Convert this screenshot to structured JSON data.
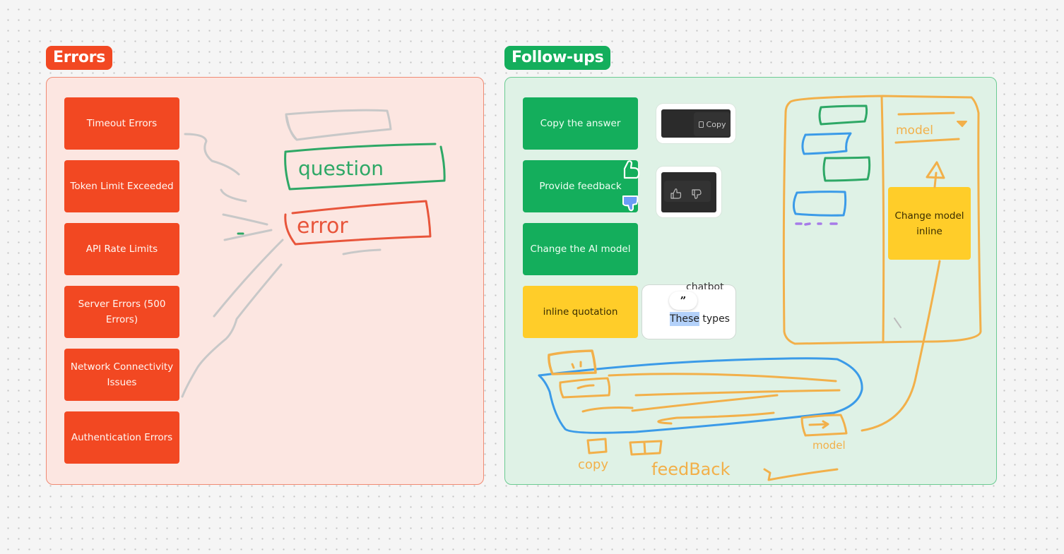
{
  "sections": {
    "errors": {
      "title": "Errors",
      "color": "#f24822",
      "stickies": [
        "Timeout Errors",
        "Token Limit Exceeded",
        "API Rate Limits",
        "Server Errors (500 Errors)",
        "Network Connectivity Issues",
        "Authentication Errors"
      ],
      "sketch_labels": {
        "question": "question",
        "error": "error"
      }
    },
    "followups": {
      "title": "Follow-ups",
      "color": "#14ae5c",
      "stickies": {
        "copy": "Copy the answer",
        "feedback": "Provide feedback",
        "change_model": "Change the AI model",
        "inline_quotation": "inline quotation",
        "change_model_inline": "Change model inline"
      },
      "screenshots": {
        "copy_button_label": "Copy",
        "quote_partial_text": "chatbot",
        "quote_selected_word": "These",
        "quote_rest_text": " types",
        "quote_icon": "”"
      },
      "sketch_labels": {
        "model_dropdown": "model",
        "copy": "copy",
        "feedback": "feedBack",
        "model": "model"
      }
    }
  },
  "colors": {
    "ink_gray": "#c4c4c4",
    "ink_green": "#2ea866",
    "ink_red": "#e8553b",
    "ink_orange": "#f2b04a",
    "ink_blue": "#3b9be8",
    "ink_purple": "#a77be8"
  }
}
